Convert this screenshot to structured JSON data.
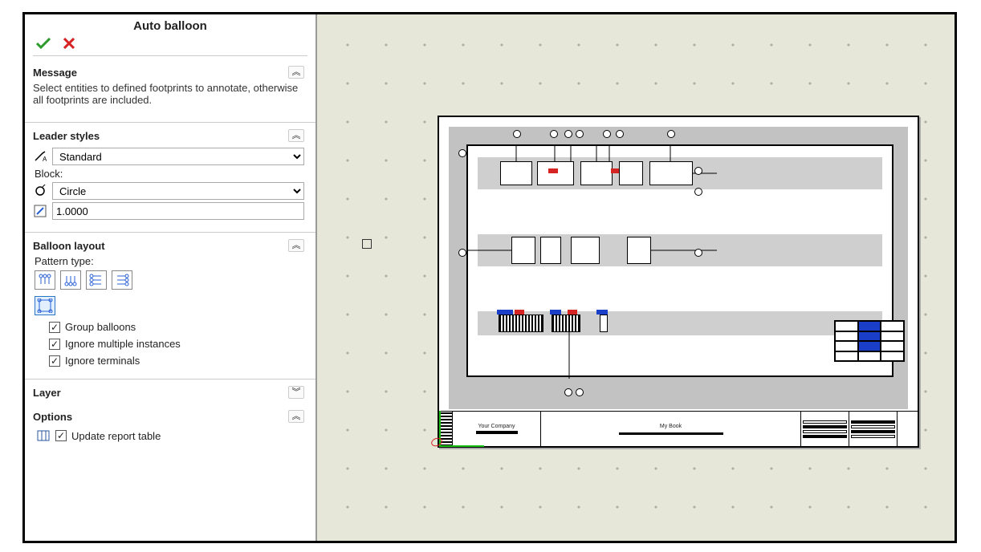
{
  "panel": {
    "title": "Auto balloon",
    "message_section": {
      "title": "Message",
      "text": "Select entities to defined footprints to annotate, otherwise all footprints are included."
    },
    "leader_styles": {
      "title": "Leader styles",
      "style_dropdown": "Standard",
      "block_label": "Block:",
      "block_dropdown": "Circle",
      "scale_value": "1.0000"
    },
    "balloon_layout": {
      "title": "Balloon layout",
      "pattern_label": "Pattern type:",
      "checkboxes": {
        "group": "Group balloons",
        "ignore_multi": "Ignore multiple instances",
        "ignore_terminals": "Ignore terminals"
      }
    },
    "layer_section": {
      "title": "Layer"
    },
    "options_section": {
      "title": "Options",
      "update_report": "Update report table"
    }
  },
  "sheet": {
    "company": "Your Company",
    "title": "My Book"
  }
}
